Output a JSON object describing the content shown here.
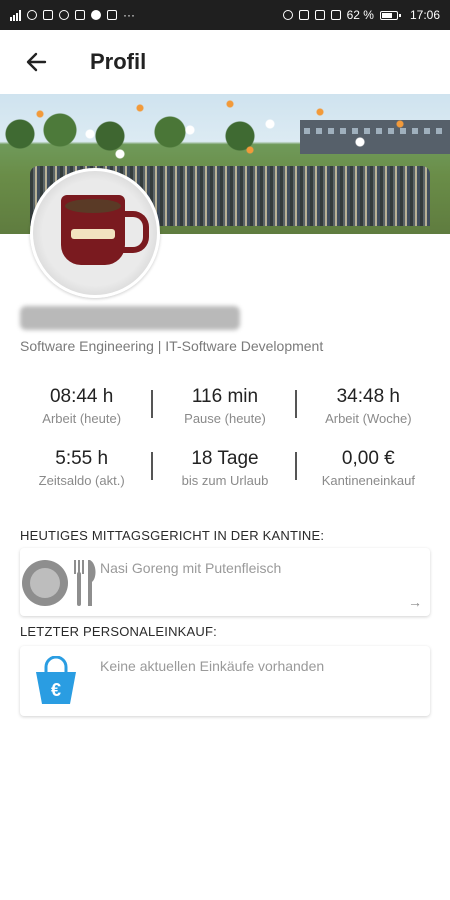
{
  "status_bar": {
    "time": "17:06",
    "battery": "62 %"
  },
  "app_bar": {
    "title": "Profil"
  },
  "profile": {
    "department": "Software Engineering | IT-Software Development"
  },
  "stats": [
    {
      "value": "08:44 h",
      "label": "Arbeit (heute)"
    },
    {
      "value": "116 min",
      "label": "Pause (heute)"
    },
    {
      "value": "34:48 h",
      "label": "Arbeit (Woche)"
    },
    {
      "value": "5:55 h",
      "label": "Zeitsaldo (akt.)"
    },
    {
      "value": "18 Tage",
      "label": "bis zum Urlaub"
    },
    {
      "value": "0,00 €",
      "label": "Kantineneinkauf"
    }
  ],
  "lunch": {
    "title": "HEUTIGES MITTAGSGERICHT IN DER KANTINE:",
    "dish": "Nasi Goreng mit Putenfleisch",
    "arrow": "→"
  },
  "shopping": {
    "title": "LETZTER PERSONALEINKAUF:",
    "text": "Keine aktuellen Einkäufe vorhanden"
  },
  "colors": {
    "bag_blue": "#2a9de2",
    "status_bar": "#1f1f1f"
  }
}
